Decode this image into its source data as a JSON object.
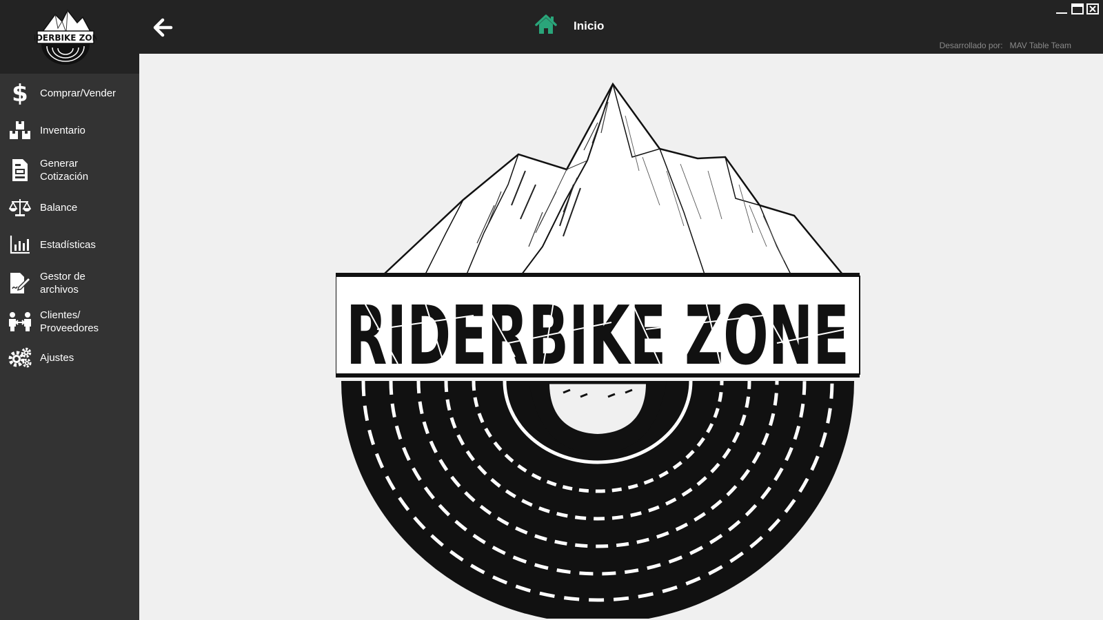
{
  "app": {
    "logo_text": "RIDERBIKE ZONE",
    "brand_colors": {
      "sidebar": "#333333",
      "topbar": "#232323",
      "home_icon": "#2aa57a",
      "content_bg": "#f0f0f0"
    }
  },
  "sidebar": {
    "items": [
      {
        "label": "Comprar/Vender",
        "icon": "dollar-icon"
      },
      {
        "label": "Inventario",
        "icon": "boxes-icon"
      },
      {
        "label": "Generar\nCotización",
        "icon": "document-icon"
      },
      {
        "label": "Balance",
        "icon": "scale-icon"
      },
      {
        "label": "Estadísticas",
        "icon": "bar-chart-icon"
      },
      {
        "label": "Gestor de\narchivos",
        "icon": "file-signature-icon"
      },
      {
        "label": "Clientes/\nProveedores",
        "icon": "people-exchange-icon"
      },
      {
        "label": "Ajustes",
        "icon": "gears-icon"
      }
    ]
  },
  "header": {
    "title": "Inicio",
    "developed_by_label": "Desarrollado por:",
    "developed_by_team": "MAV Table Team"
  },
  "window_controls": [
    "minimize",
    "maximize",
    "close"
  ]
}
